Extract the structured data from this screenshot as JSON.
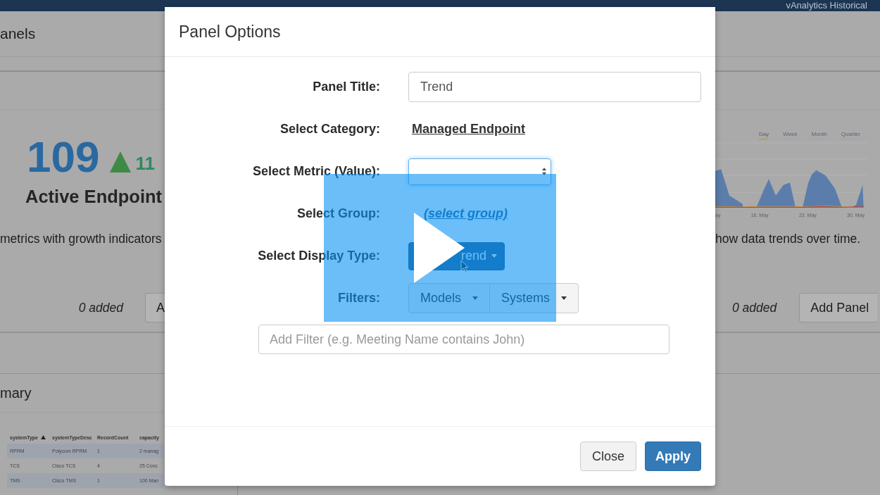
{
  "top_bar": {
    "title": "vAnalytics Historical"
  },
  "page": {
    "heading": "anels"
  },
  "cards": [
    {
      "kind": "metric",
      "value": "109",
      "change": "11",
      "label": "Active Endpoint",
      "description": "metrics with growth indicators",
      "added": "0 added",
      "button": "A"
    },
    {
      "kind": "chart",
      "ranges": [
        {
          "label": "Day",
          "selected": true
        },
        {
          "label": "Week",
          "selected": false
        },
        {
          "label": "Month",
          "selected": false
        },
        {
          "label": "Quarter",
          "selected": false
        }
      ],
      "x_labels": [
        "ay",
        "16. May",
        "23. May",
        "30. May"
      ],
      "description": "how data trends over time.",
      "added": "0 added",
      "button": "Add Panel"
    }
  ],
  "summary": {
    "heading": "mary",
    "table": {
      "columns": [
        {
          "label": "systemType",
          "sorted": true
        },
        {
          "label": "systemTypeDesc",
          "sorted": false
        },
        {
          "label": "RecordCount",
          "sorted": false
        },
        {
          "label": "capacity",
          "sorted": false
        }
      ],
      "rows": [
        [
          "RPRM",
          "Polycom RPRM",
          "1",
          "2 manag"
        ],
        [
          "TCS",
          "Cisco TCS",
          "4",
          "25 Conc"
        ],
        [
          "TMS",
          "Cisco TMS",
          "1",
          "100 Man"
        ]
      ]
    }
  },
  "modal": {
    "title": "Panel Options",
    "fields": [
      {
        "kind": "input",
        "label": "Panel Title:",
        "value": "Trend"
      },
      {
        "kind": "link",
        "label": "Select Category:",
        "value": "Managed Endpoint"
      },
      {
        "kind": "select",
        "label": "Select Metric (Value):",
        "focused": true
      },
      {
        "kind": "prompt",
        "label": "Select Group:",
        "value": "(select group)"
      },
      {
        "kind": "dropdown",
        "label": "Select Display Type:",
        "value": "rend"
      },
      {
        "kind": "button_group",
        "label": "Filters:",
        "options": [
          "Models",
          "Systems"
        ]
      }
    ],
    "filter_field": {
      "placeholder": "Add Filter (e.g. Meeting Name contains John)"
    },
    "buttons": [
      {
        "label": "Close",
        "kind": "default"
      },
      {
        "label": "Apply",
        "kind": "primary"
      }
    ]
  }
}
